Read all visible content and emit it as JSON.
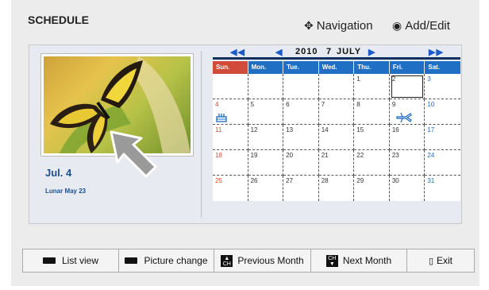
{
  "header": {
    "title": "SCHEDULE",
    "nav_icon": "four-arrow-icon",
    "nav_label": "Navigation",
    "add_icon": "radio-dot-icon",
    "add_label": "Add/Edit"
  },
  "left": {
    "date": "Jul. 4",
    "lunar": "Lunar May 23"
  },
  "calendar": {
    "year": "2010",
    "month_num": "7",
    "month_name": "JULY",
    "weekdays": [
      "Sun.",
      "Mon.",
      "Tue.",
      "Wed.",
      "Thu.",
      "Fri.",
      "Sat."
    ],
    "weeks": [
      [
        "",
        "",
        "",
        "",
        "1",
        "2",
        "3"
      ],
      [
        "4",
        "5",
        "6",
        "7",
        "8",
        "9",
        "10"
      ],
      [
        "11",
        "12",
        "13",
        "14",
        "15",
        "16",
        "17"
      ],
      [
        "18",
        "19",
        "20",
        "21",
        "22",
        "23",
        "24"
      ],
      [
        "25",
        "26",
        "27",
        "28",
        "29",
        "30",
        "31"
      ]
    ],
    "selected_day": "2",
    "events": [
      {
        "day": "4",
        "icon": "birthday-cake-icon"
      },
      {
        "day": "9",
        "icon": "airplane-icon"
      }
    ],
    "colors": {
      "sunday": "#d24a3a",
      "saturday": "#1b68c6",
      "header": "#1f6fc4"
    }
  },
  "buttons": {
    "list_view": "List view",
    "picture_change": "Picture change",
    "prev_month": "Previous Month",
    "next_month": "Next Month",
    "exit": "Exit"
  }
}
